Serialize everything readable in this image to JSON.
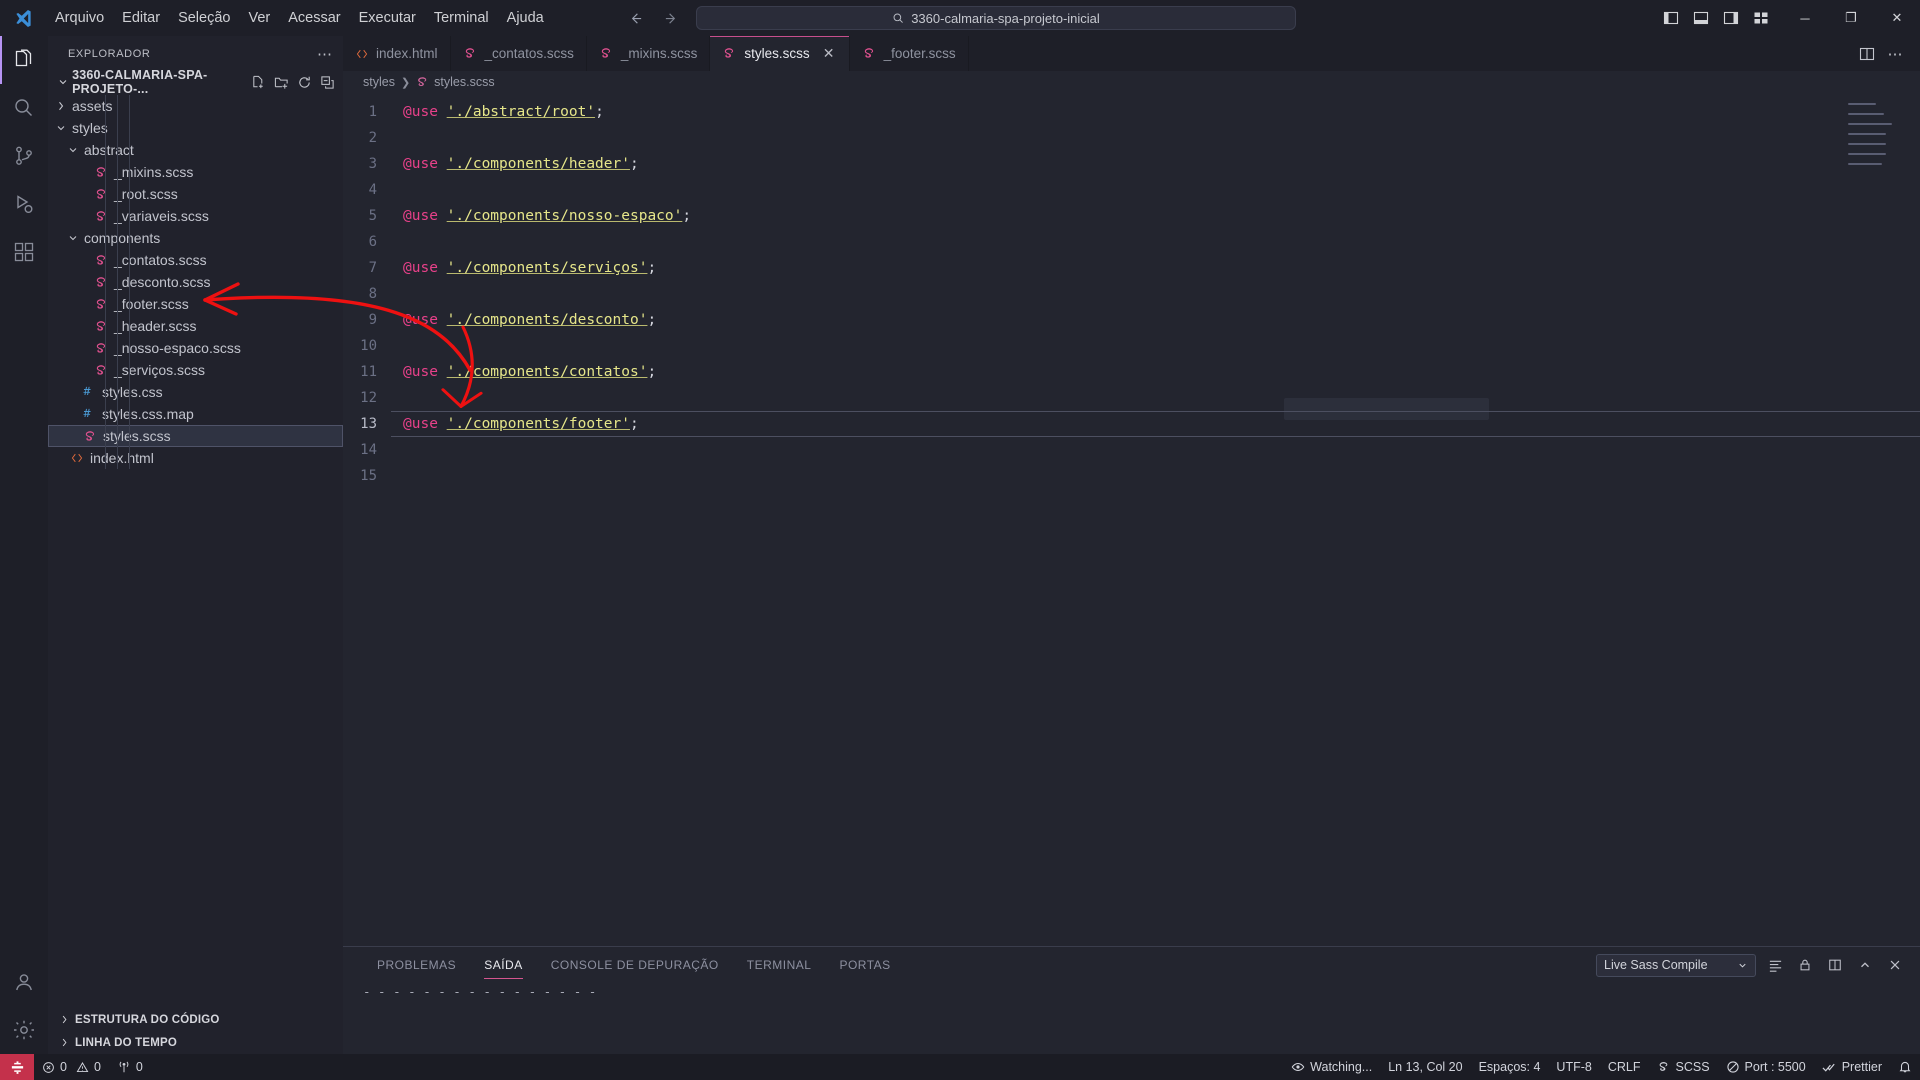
{
  "titlebar": {
    "menu": [
      "Arquivo",
      "Editar",
      "Seleção",
      "Ver",
      "Acessar",
      "Executar",
      "Terminal",
      "Ajuda"
    ],
    "back_icon": "arrow-left-icon",
    "forward_icon": "arrow-right-icon",
    "command_center_value": "3360-calmaria-spa-projeto-inicial",
    "search_icon": "search-icon",
    "layout_icons": [
      "toggle-primary-sidebar-icon",
      "toggle-panel-icon",
      "toggle-secondary-sidebar-icon",
      "customize-layout-icon"
    ],
    "window_controls": {
      "minimize": "─",
      "maximize": "❐",
      "close": "✕"
    }
  },
  "activitybar": {
    "items": [
      {
        "name": "explorer",
        "icon": "files-icon",
        "active": true
      },
      {
        "name": "search",
        "icon": "search-icon",
        "active": false
      },
      {
        "name": "source-control",
        "icon": "source-control-icon",
        "active": false
      },
      {
        "name": "run-and-debug",
        "icon": "run-debug-icon",
        "active": false
      },
      {
        "name": "extensions",
        "icon": "extensions-icon",
        "active": false
      }
    ],
    "bottom": [
      {
        "name": "accounts",
        "icon": "account-icon",
        "badge": ""
      },
      {
        "name": "manage",
        "icon": "gear-icon",
        "badge": ""
      }
    ]
  },
  "sidebar": {
    "title": "EXPLORADOR",
    "more_actions_icon": "ellipsis-icon",
    "folder": {
      "label": "3360-CALMARIA-SPA-PROJETO-...",
      "expanded": true,
      "actions": [
        "new-file-icon",
        "new-folder-icon",
        "refresh-icon",
        "collapse-all-icon"
      ]
    },
    "tree": [
      {
        "label": "assets",
        "type": "folder",
        "expanded": false,
        "depth": 1,
        "icon": "chevron-right-icon"
      },
      {
        "label": "styles",
        "type": "folder",
        "expanded": true,
        "depth": 1,
        "icon": "chevron-down-icon"
      },
      {
        "label": "abstract",
        "type": "folder",
        "expanded": true,
        "depth": 2,
        "icon": "chevron-down-icon"
      },
      {
        "label": "_mixins.scss",
        "type": "scss",
        "depth": 3,
        "icon": "sass-icon"
      },
      {
        "label": "_root.scss",
        "type": "scss",
        "depth": 3,
        "icon": "sass-icon"
      },
      {
        "label": "_variaveis.scss",
        "type": "scss",
        "depth": 3,
        "icon": "sass-icon"
      },
      {
        "label": "components",
        "type": "folder",
        "expanded": true,
        "depth": 2,
        "icon": "chevron-down-icon"
      },
      {
        "label": "_contatos.scss",
        "type": "scss",
        "depth": 3,
        "icon": "sass-icon"
      },
      {
        "label": "_desconto.scss",
        "type": "scss",
        "depth": 3,
        "icon": "sass-icon"
      },
      {
        "label": "_footer.scss",
        "type": "scss",
        "depth": 3,
        "icon": "sass-icon"
      },
      {
        "label": "_header.scss",
        "type": "scss",
        "depth": 3,
        "icon": "sass-icon"
      },
      {
        "label": "_nosso-espaco.scss",
        "type": "scss",
        "depth": 3,
        "icon": "sass-icon"
      },
      {
        "label": "_serviços.scss",
        "type": "scss",
        "depth": 3,
        "icon": "sass-icon"
      },
      {
        "label": "styles.css",
        "type": "css",
        "depth": 2,
        "icon": "css-icon"
      },
      {
        "label": "styles.css.map",
        "type": "css",
        "depth": 2,
        "icon": "css-icon"
      },
      {
        "label": "styles.scss",
        "type": "scss",
        "depth": 2,
        "icon": "sass-icon",
        "selected": true
      },
      {
        "label": "index.html",
        "type": "html",
        "depth": 1,
        "icon": "html-icon"
      }
    ]
  },
  "editor": {
    "tabs": [
      {
        "label": "index.html",
        "icon": "html-icon",
        "active": false,
        "dirty": false
      },
      {
        "label": "_contatos.scss",
        "icon": "sass-icon",
        "active": false,
        "dirty": false
      },
      {
        "label": "_mixins.scss",
        "icon": "sass-icon",
        "active": false,
        "dirty": false
      },
      {
        "label": "styles.scss",
        "icon": "sass-icon",
        "active": true,
        "dirty": false,
        "close_icon": "close-icon"
      },
      {
        "label": "_footer.scss",
        "icon": "sass-icon",
        "active": false,
        "dirty": false
      }
    ],
    "tab_actions": [
      "split-editor-icon",
      "more-actions-icon"
    ],
    "breadcrumb": [
      "styles",
      "styles.scss"
    ],
    "breadcrumb_icon": "sass-icon",
    "lines": [
      {
        "n": 1,
        "kw": "@use",
        "str": "'./abstract/root'",
        "end": ";"
      },
      {
        "n": 2,
        "kw": "",
        "str": "",
        "end": ""
      },
      {
        "n": 3,
        "kw": "@use",
        "str": "'./components/header'",
        "end": ";"
      },
      {
        "n": 4,
        "kw": "",
        "str": "",
        "end": ""
      },
      {
        "n": 5,
        "kw": "@use",
        "str": "'./components/nosso-espaco'",
        "end": ";"
      },
      {
        "n": 6,
        "kw": "",
        "str": "",
        "end": ""
      },
      {
        "n": 7,
        "kw": "@use",
        "str": "'./components/serviços'",
        "end": ";"
      },
      {
        "n": 8,
        "kw": "",
        "str": "",
        "end": ""
      },
      {
        "n": 9,
        "kw": "@use",
        "str": "'./components/desconto'",
        "end": ";"
      },
      {
        "n": 10,
        "kw": "",
        "str": "",
        "end": ""
      },
      {
        "n": 11,
        "kw": "@use",
        "str": "'./components/contatos'",
        "end": ";"
      },
      {
        "n": 12,
        "kw": "",
        "str": "",
        "end": ""
      },
      {
        "n": 13,
        "kw": "@use",
        "str": "'./components/footer'",
        "end": ";",
        "active": true
      },
      {
        "n": 14,
        "kw": "",
        "str": "",
        "end": ""
      },
      {
        "n": 15,
        "kw": "",
        "str": "",
        "end": ""
      }
    ]
  },
  "panel": {
    "tabs": [
      "PROBLEMAS",
      "SAÍDA",
      "CONSOLE DE DEPURAÇÃO",
      "TERMINAL",
      "PORTAS"
    ],
    "active_tab": "SAÍDA",
    "output_channel": "Live Sass Compile",
    "channel_chevron": "chevron-down-icon",
    "actions": [
      "clear-output-icon",
      "lock-icon",
      "split-panel-icon",
      "maximize-panel-icon",
      "close-panel-icon"
    ],
    "output_lines": [
      "- - - - - - - - - - - - - - - -"
    ]
  },
  "bottom_sections": [
    {
      "label": "ESTRUTURA DO CÓDIGO",
      "icon": "chevron-right-icon"
    },
    {
      "label": "LINHA DO TEMPO",
      "icon": "chevron-right-icon"
    }
  ],
  "statusbar": {
    "remote_icon": "remote-window-icon",
    "left": [
      {
        "name": "problems",
        "icon": "error-icon",
        "text": "0",
        "icon2": "warning-icon",
        "text2": "0"
      },
      {
        "name": "ports",
        "icon": "radio-tower-icon",
        "text": "0"
      }
    ],
    "right": [
      {
        "name": "live-sass-watching",
        "icon": "eye-watch-icon",
        "text": "Watching..."
      },
      {
        "name": "cursor-position",
        "text": "Ln 13, Col 20"
      },
      {
        "name": "indentation",
        "text": "Espaços: 4"
      },
      {
        "name": "encoding",
        "text": "UTF-8"
      },
      {
        "name": "eol",
        "text": "CRLF"
      },
      {
        "name": "language-mode",
        "icon": "sass-icon",
        "text": "SCSS"
      },
      {
        "name": "live-server-port",
        "icon": "circle-slash-icon",
        "text": "Port : 5500"
      },
      {
        "name": "prettier",
        "icon": "check-check-icon",
        "text": "Prettier"
      },
      {
        "name": "notifications",
        "icon": "bell-icon",
        "text": ""
      }
    ]
  },
  "annotations": {
    "arrow_color": "#ee1111",
    "arrows": [
      {
        "name": "arrow-to-footer-scss"
      },
      {
        "name": "arrow-to-line-14"
      }
    ]
  },
  "colors": {
    "accent_pink": "#e8418a",
    "string_yellow": "#e6e68a",
    "bg": "#23252f",
    "sidebar_bg": "#21222c",
    "titlebar_bg": "#1e1f28",
    "statusbar_bg": "#1b1c24",
    "remote_red": "#c4314b"
  }
}
